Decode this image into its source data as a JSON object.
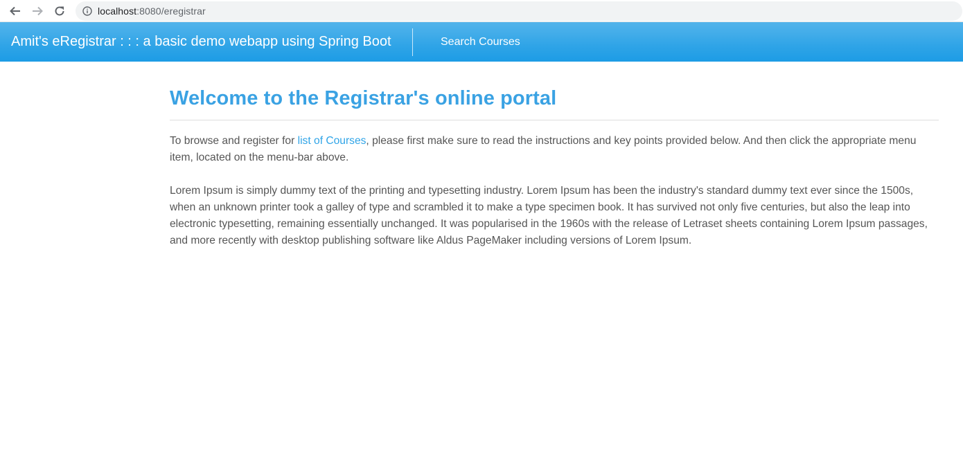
{
  "browser": {
    "url_host": "localhost",
    "url_rest": ":8080/eregistrar"
  },
  "navbar": {
    "brand": "Amit's eRegistrar : : : a basic demo webapp using Spring Boot",
    "search_link": "Search Courses"
  },
  "main": {
    "title": "Welcome to the Registrar's online portal",
    "intro_before": "To browse and register for ",
    "intro_link": "list of Courses",
    "intro_after": ", please first make sure to read the instructions and key points provided below. And then click the appropriate menu item, located on the menu-bar above.",
    "lorem": "Lorem Ipsum is simply dummy text of the printing and typesetting industry. Lorem Ipsum has been the industry's standard dummy text ever since the 1500s, when an unknown printer took a galley of type and scrambled it to make a type specimen book. It has survived not only five centuries, but also the leap into electronic typesetting, remaining essentially unchanged. It was popularised in the 1960s with the release of Letraset sheets containing Lorem Ipsum passages, and more recently with desktop publishing software like Aldus PageMaker including versions of Lorem Ipsum."
  },
  "icons": {
    "back": "back-arrow-icon",
    "forward": "forward-arrow-icon",
    "reload": "reload-icon",
    "info": "info-icon"
  },
  "colors": {
    "navbar": "#2fa4e7",
    "title": "#3aa2e3",
    "link": "#2fa4e7",
    "text": "#555555"
  }
}
